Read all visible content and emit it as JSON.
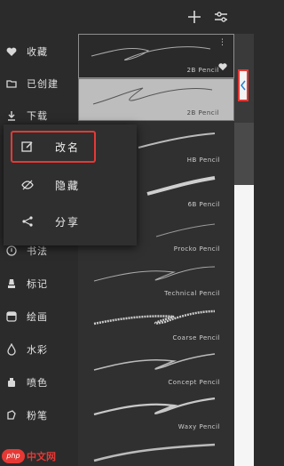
{
  "toolbar": {
    "add_icon": "plus-icon",
    "settings_icon": "sliders-icon"
  },
  "sidebar": {
    "items": [
      {
        "label": "收藏",
        "icon": "heart-icon"
      },
      {
        "label": "已创建",
        "icon": "folder-icon"
      },
      {
        "label": "下载",
        "icon": "download-icon"
      },
      {
        "label": "书法",
        "icon": "pen-nib-icon"
      },
      {
        "label": "标记",
        "icon": "marker-icon"
      },
      {
        "label": "绘画",
        "icon": "paint-icon"
      },
      {
        "label": "水彩",
        "icon": "drop-icon"
      },
      {
        "label": "喷色",
        "icon": "airbrush-icon"
      },
      {
        "label": "粉笔",
        "icon": "chalk-icon"
      }
    ]
  },
  "brushes": [
    {
      "name": "2B Pencil"
    },
    {
      "name": "2B Pencil"
    },
    {
      "name": "HB Pencil"
    },
    {
      "name": "6B Pencil"
    },
    {
      "name": "Procko Pencil"
    },
    {
      "name": "Technical Pencil"
    },
    {
      "name": "Coarse Pencil"
    },
    {
      "name": "Concept Pencil"
    },
    {
      "name": "Waxy Pencil"
    }
  ],
  "context_menu": {
    "items": [
      {
        "label": "改名",
        "icon": "edit-icon"
      },
      {
        "label": "隐藏",
        "icon": "eye-off-icon"
      },
      {
        "label": "分享",
        "icon": "share-icon"
      }
    ]
  },
  "watermark": {
    "badge": "php",
    "text": "中文网"
  },
  "colors": {
    "accent": "#e53935",
    "background": "#2b2b2b",
    "selected_card": "#bdbdbd"
  }
}
